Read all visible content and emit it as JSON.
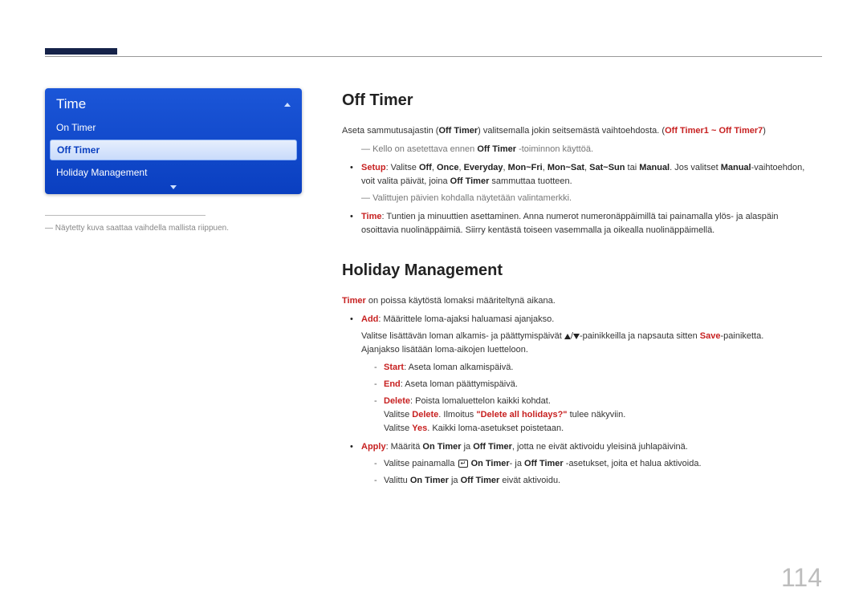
{
  "osd": {
    "title": "Time",
    "items": [
      "On Timer",
      "Off Timer",
      "Holiday Management"
    ],
    "selected_index": 1
  },
  "left_note": "Näytetty kuva saattaa vaihdella mallista riippuen.",
  "offtimer": {
    "heading": "Off Timer",
    "intro_pre": "Aseta sammutusajastin (",
    "intro_bold1": "Off Timer",
    "intro_mid": ") valitsemalla jokin seitsemästä vaihtoehdosta. (",
    "intro_bold2": "Off Timer1 ~ Off Timer7",
    "intro_post": ")",
    "note_pre": "Kello on asetettava ennen ",
    "note_bold": "Off Timer",
    "note_post": " -toiminnon käyttöä.",
    "setup": {
      "label": "Setup",
      "pre": ": Valitse ",
      "off": "Off",
      "once": "Once",
      "everyday": "Everyday",
      "monfri": "Mon~Fri",
      "monsat": "Mon~Sat",
      "satsun": "Sat~Sun",
      "tai": " tai ",
      "manual": "Manual",
      "mid": ". Jos valitset ",
      "manual2": "Manual",
      "after": "-vaihtoehdon, voit valita päivät, joina ",
      "offtimer": "Off Timer",
      "end": " sammuttaa tuotteen.",
      "subnote": "Valittujen päivien kohdalla näytetään valintamerkki."
    },
    "time": {
      "label": "Time",
      "text": ": Tuntien ja minuuttien asettaminen. Anna numerot numeronäppäimillä tai painamalla ylös- ja alaspäin osoittavia nuolinäppäimiä. Siirry kentästä toiseen vasemmalla ja oikealla nuolinäppäimellä."
    }
  },
  "holiday": {
    "heading": "Holiday Management",
    "intro_bold": "Timer",
    "intro_text": " on poissa käytöstä lomaksi määriteltynä aikana.",
    "add": {
      "label": "Add",
      "text": ": Määrittele loma-ajaksi haluamasi ajanjakso.",
      "line1_pre": "Valitse lisättävän loman alkamis- ja päättymispäivät ",
      "line1_mid": "/",
      "line1_mid2": "-painikkeilla ja napsauta sitten ",
      "save": "Save",
      "line1_end": "-painiketta.",
      "line2": "Ajanjakso lisätään loma-aikojen luetteloon."
    },
    "start": {
      "label": "Start",
      "text": ": Aseta loman alkamispäivä."
    },
    "end": {
      "label": "End",
      "text": ": Aseta loman päättymispäivä."
    },
    "delete": {
      "label": "Delete",
      "text": ": Poista lomaluettelon kaikki kohdat.",
      "line1_pre": "Valitse ",
      "del": "Delete",
      "line1_mid": ". Ilmoitus ",
      "quote": "\"Delete all holidays?\"",
      "line1_end": " tulee näkyviin.",
      "line2_pre": "Valitse ",
      "yes": "Yes",
      "line2_end": ". Kaikki loma-asetukset poistetaan."
    },
    "apply": {
      "label": "Apply",
      "pre": ": Määritä ",
      "ontimer": "On Timer",
      "and": " ja ",
      "offtimer": "Off Timer",
      "end": ", jotta ne eivät aktivoidu yleisinä juhlapäivinä.",
      "d1_pre": "Valitse painamalla ",
      "d1_on": "On Timer",
      "d1_mid": "- ja ",
      "d1_off": "Off Timer",
      "d1_end": " -asetukset, joita et halua aktivoida.",
      "d2_pre": "Valittu ",
      "d2_on": "On Timer",
      "d2_and": " ja ",
      "d2_off": "Off Timer",
      "d2_end": " eivät aktivoidu."
    }
  },
  "page_number": "114"
}
